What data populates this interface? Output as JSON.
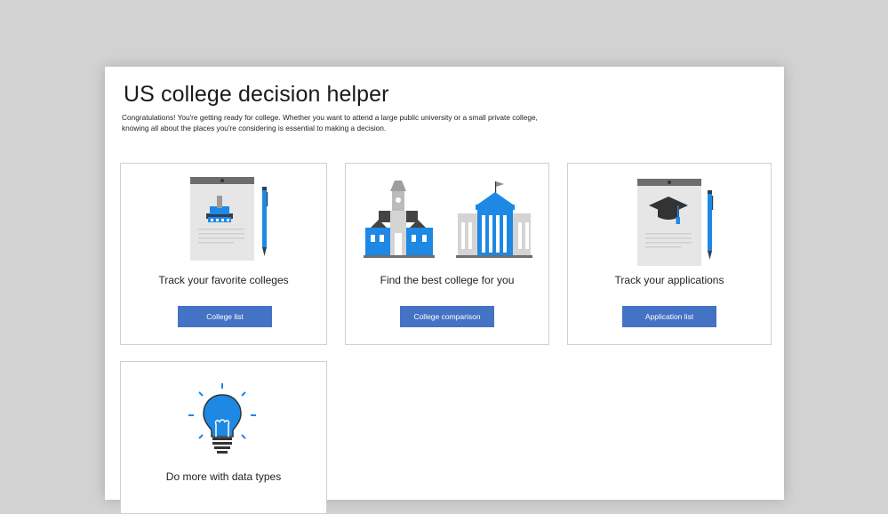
{
  "header": {
    "title": "US college decision helper",
    "subtitle": "Congratulations! You're getting ready for college. Whether you want to attend a large public university or a small private college, knowing all about the places you're considering is essential to making a decision."
  },
  "cards": [
    {
      "label": "Track your favorite colleges",
      "button": "College list",
      "icon": "college-notepad-icon"
    },
    {
      "label": "Find the best college for you",
      "button": "College comparison",
      "icon": "college-buildings-icon"
    },
    {
      "label": "Track your applications",
      "button": "Application list",
      "icon": "graduation-notepad-icon"
    },
    {
      "label": "Do more with data types",
      "icon": "lightbulb-icon"
    }
  ],
  "colors": {
    "accent": "#4472c4",
    "icon_blue": "#1e88e5",
    "background": "#d2d2d2"
  }
}
